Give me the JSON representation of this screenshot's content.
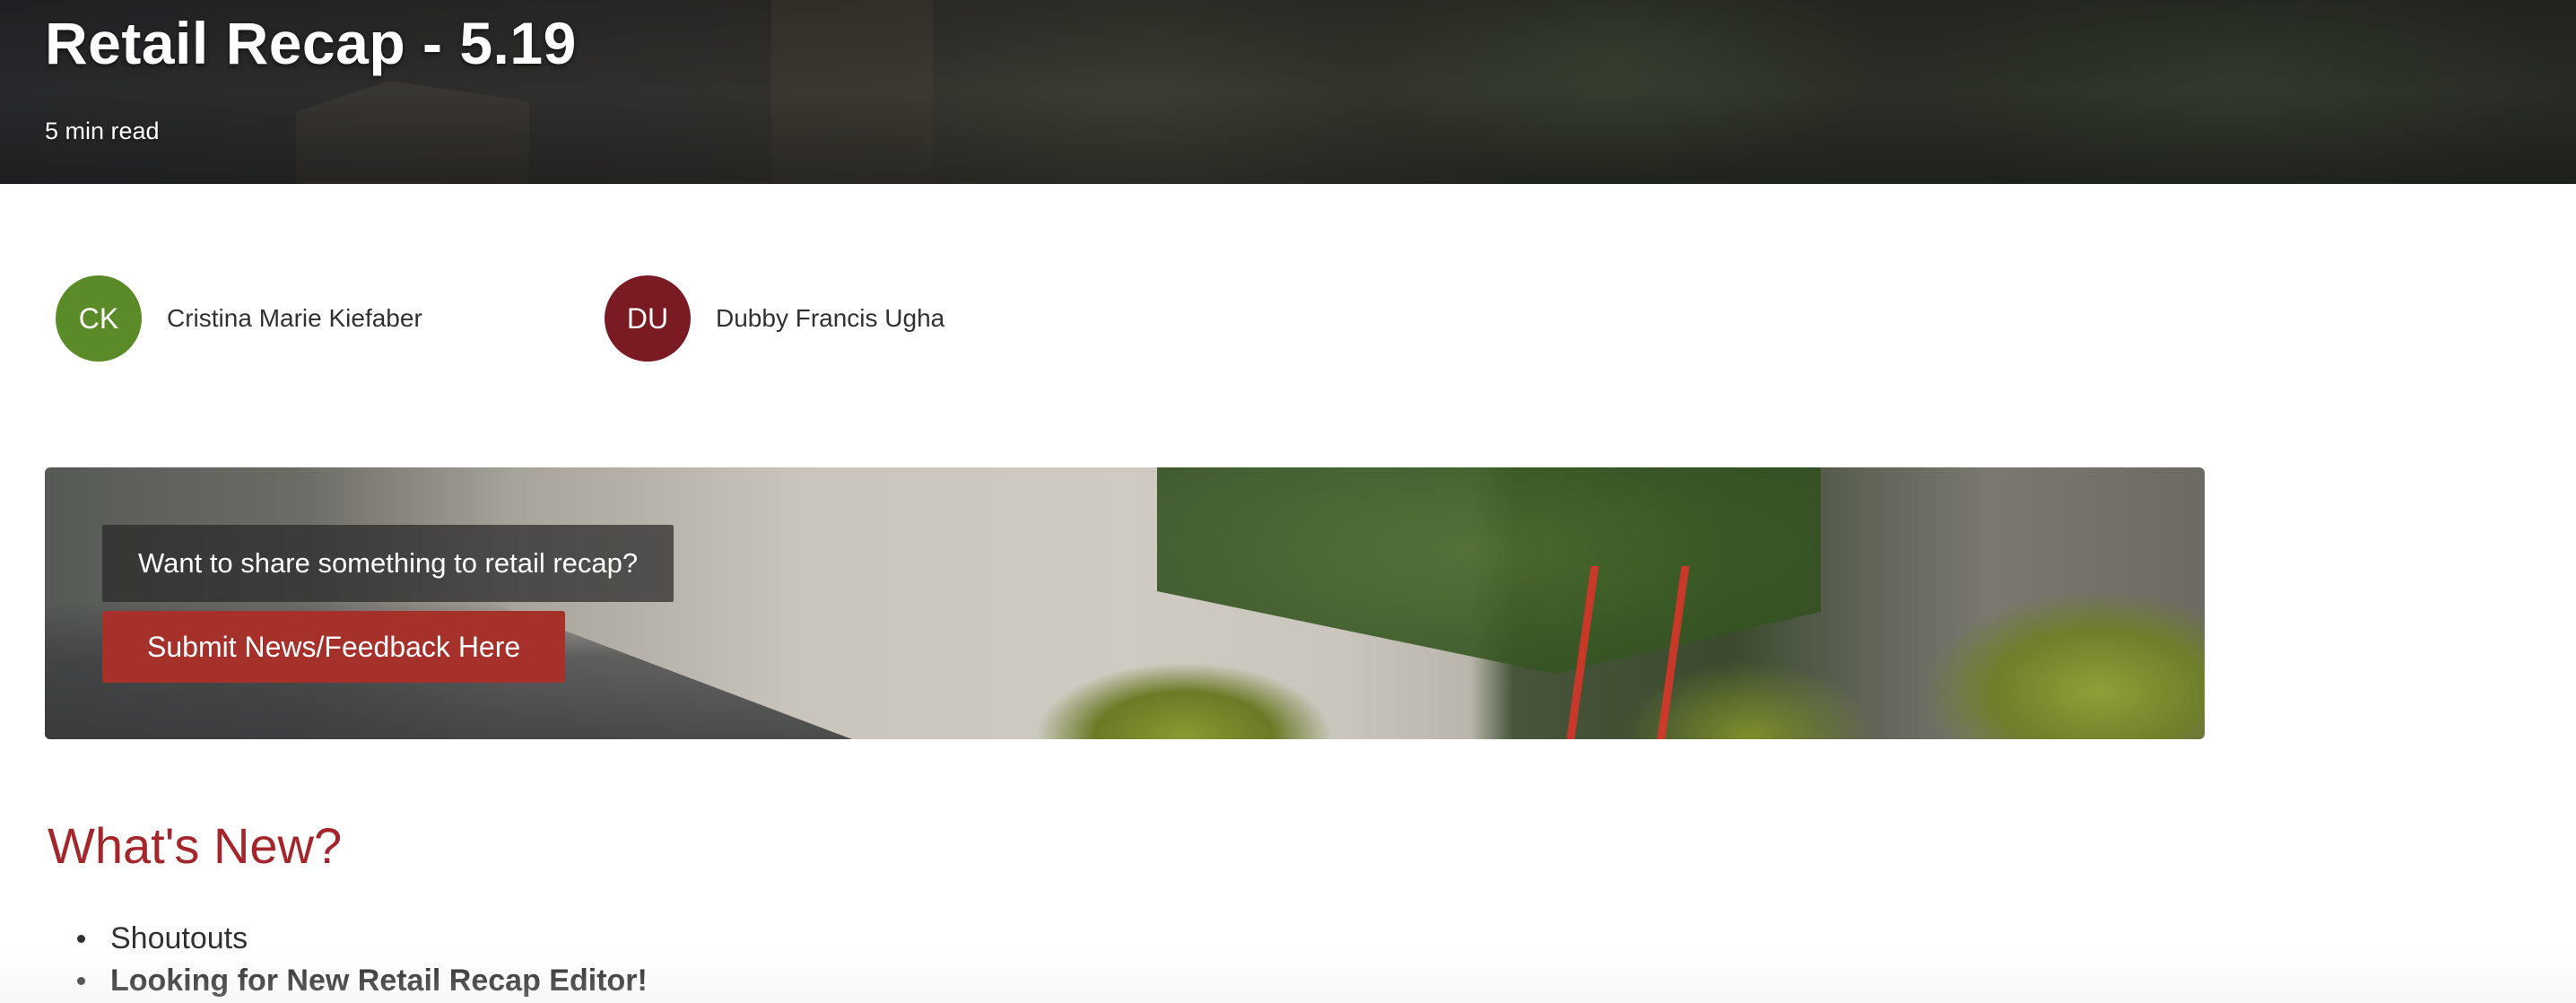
{
  "hero": {
    "title": "Retail Recap - 5.19",
    "read_time": "5 min read"
  },
  "authors": [
    {
      "initials": "CK",
      "name": "Cristina Marie Kiefaber",
      "color": "#5b8a28"
    },
    {
      "initials": "DU",
      "name": "Dubby Francis Ugha",
      "color": "#7a1a22"
    }
  ],
  "banner": {
    "question": "Want to share something to retail recap?",
    "button_label": "Submit News/Feedback Here"
  },
  "whats_new": {
    "heading": "What's New?",
    "items": [
      {
        "label": "Shoutouts"
      },
      {
        "label": "Looking for New Retail Recap Editor!"
      }
    ]
  },
  "colors": {
    "accent": "#a4262c",
    "button": "#a6302a"
  }
}
